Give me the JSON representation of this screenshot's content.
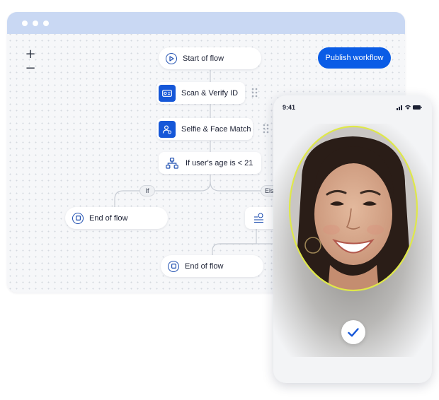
{
  "builder": {
    "zoom_in": "+",
    "zoom_out": "−",
    "publish_label": "Publish workflow",
    "nodes": {
      "start": "Start of flow",
      "scan": "Scan & Verify ID",
      "selfie": "Selfie & Face Match",
      "condition": "If user's age is < 21",
      "end_left": "End of flow",
      "end_bottom": "End of flow"
    },
    "branches": {
      "if": "If",
      "else": "Else"
    }
  },
  "phone": {
    "time": "9:41"
  },
  "colors": {
    "accent": "#0a5ce6",
    "titlebar": "#c9d8f3",
    "face_outline": "#dfe84a"
  }
}
